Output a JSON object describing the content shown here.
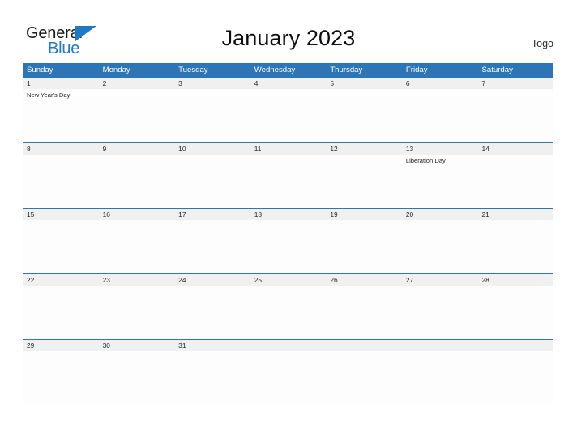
{
  "brand": {
    "name_part1": "General",
    "name_part2": "Blue",
    "mark_icon": "blue-triangle-flag-icon",
    "accent_color": "#1f7ac4"
  },
  "header": {
    "title": "January 2023",
    "country": "Togo"
  },
  "theme": {
    "header_blue": "#2e75b6",
    "number_band_gray": "#f0f0f0",
    "cell_background": "#fdfdfd",
    "page_background": "#ffffff"
  },
  "calendar": {
    "month": "January",
    "year": "2023",
    "weekday_headers": [
      "Sunday",
      "Monday",
      "Tuesday",
      "Wednesday",
      "Thursday",
      "Friday",
      "Saturday"
    ],
    "weeks": [
      {
        "days": [
          {
            "number": "1",
            "events": [
              "New Year's Day"
            ]
          },
          {
            "number": "2",
            "events": []
          },
          {
            "number": "3",
            "events": []
          },
          {
            "number": "4",
            "events": []
          },
          {
            "number": "5",
            "events": []
          },
          {
            "number": "6",
            "events": []
          },
          {
            "number": "7",
            "events": []
          }
        ]
      },
      {
        "days": [
          {
            "number": "8",
            "events": []
          },
          {
            "number": "9",
            "events": []
          },
          {
            "number": "10",
            "events": []
          },
          {
            "number": "11",
            "events": []
          },
          {
            "number": "12",
            "events": []
          },
          {
            "number": "13",
            "events": [
              "Liberation Day"
            ]
          },
          {
            "number": "14",
            "events": []
          }
        ]
      },
      {
        "days": [
          {
            "number": "15",
            "events": []
          },
          {
            "number": "16",
            "events": []
          },
          {
            "number": "17",
            "events": []
          },
          {
            "number": "18",
            "events": []
          },
          {
            "number": "19",
            "events": []
          },
          {
            "number": "20",
            "events": []
          },
          {
            "number": "21",
            "events": []
          }
        ]
      },
      {
        "days": [
          {
            "number": "22",
            "events": []
          },
          {
            "number": "23",
            "events": []
          },
          {
            "number": "24",
            "events": []
          },
          {
            "number": "25",
            "events": []
          },
          {
            "number": "26",
            "events": []
          },
          {
            "number": "27",
            "events": []
          },
          {
            "number": "28",
            "events": []
          }
        ]
      },
      {
        "days": [
          {
            "number": "29",
            "events": []
          },
          {
            "number": "30",
            "events": []
          },
          {
            "number": "31",
            "events": []
          },
          {
            "number": "",
            "events": []
          },
          {
            "number": "",
            "events": []
          },
          {
            "number": "",
            "events": []
          },
          {
            "number": "",
            "events": []
          }
        ]
      }
    ]
  }
}
